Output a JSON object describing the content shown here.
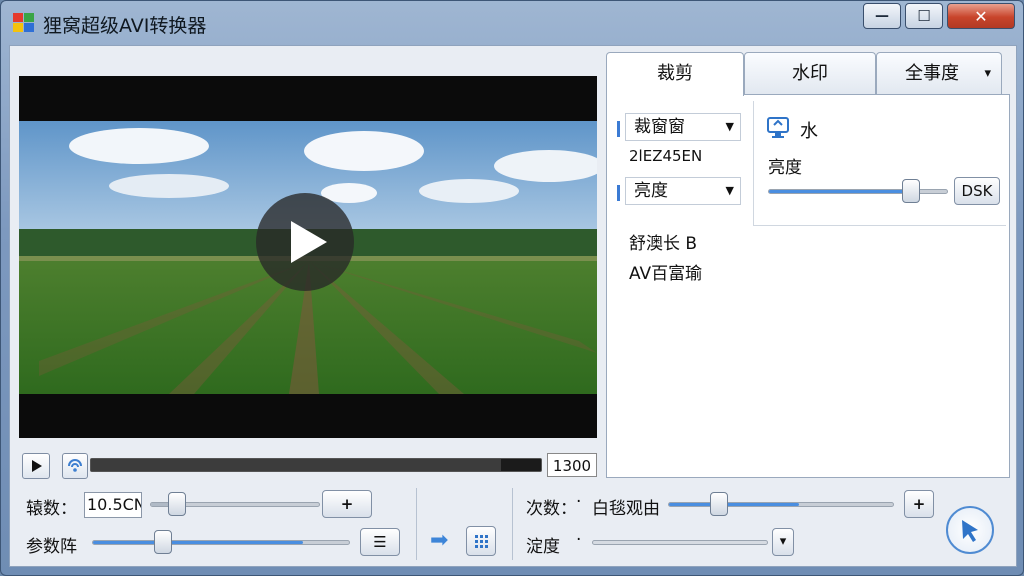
{
  "window": {
    "title": "狸窝超级AVI转换器",
    "controls": {
      "minimize": "—",
      "maximize": "☐",
      "close": "✕"
    }
  },
  "player": {
    "time": "1300",
    "play_icon": "play-icon",
    "audio_icon": "wave-icon"
  },
  "tabs": [
    {
      "label": "裁剪",
      "active": true
    },
    {
      "label": "水印",
      "active": false
    },
    {
      "label": "全事度",
      "active": false,
      "dropdown": "▾"
    }
  ],
  "crop_panel": {
    "combo1": "裁窗窗",
    "info_text": "2lEZ45EN",
    "combo2": "亮度",
    "text1": "舒澳长 B",
    "text2": "AV百富瑜"
  },
  "watermark_panel": {
    "title": "水",
    "brightness_label": "亮度",
    "button": "DSK",
    "slider_value": 0.85
  },
  "bottom": {
    "left": {
      "label1": "辕数：",
      "input1": "10.5CN",
      "button1": "+",
      "label2": "参数阵",
      "button2": "☰",
      "slider1_value": 0.16,
      "slider2_value": 0.28
    },
    "middle": {
      "arrow": "➡"
    },
    "right": {
      "label1": "次数：",
      "dot": "·",
      "label_b": "白毯观由",
      "button_plus": "+",
      "label2": "淀度",
      "dot2": "·",
      "dropdown": "▾",
      "slider1_value": 0.58,
      "slider2_value": 0.0
    }
  },
  "colors": {
    "accent": "#4a8ee0",
    "titlebar": "#8fa9cb",
    "close": "#c8442b"
  }
}
